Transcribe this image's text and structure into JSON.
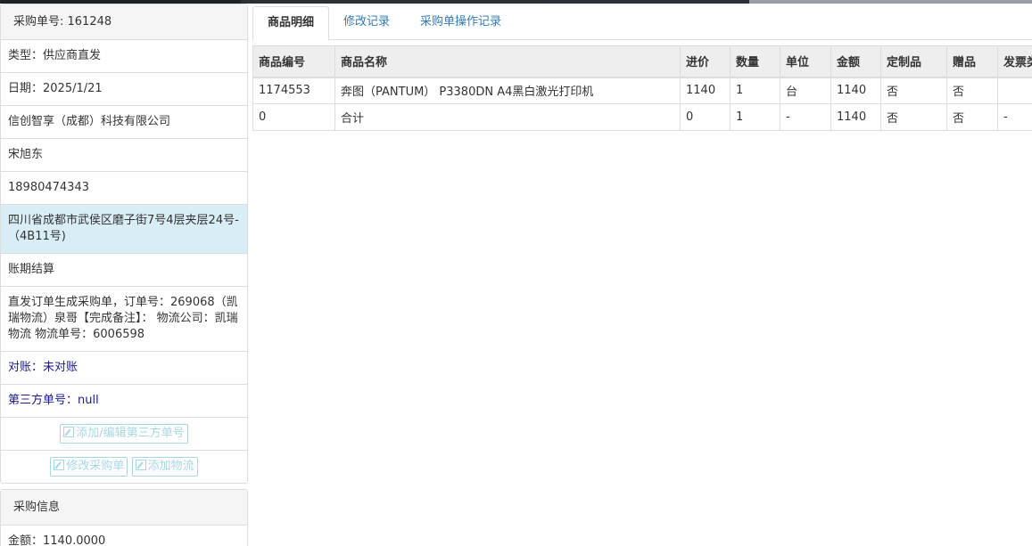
{
  "colors": {
    "link": "#337ab7",
    "highlight_row": "#d9edf7",
    "dark_link": "#1a1a8c",
    "ghost_button": "#a9d6e5"
  },
  "left_panel": {
    "heading": "采购单号: 161248",
    "rows": {
      "type": "类型：供应商直发",
      "date": "日期：2025/1/21",
      "company": "信创智享（成都）科技有限公司",
      "contact": "宋旭东",
      "phone": "18980474343",
      "address": "四川省成都市武侯区磨子街7号4层夹层24号-（4B11号)",
      "settlement": "账期结算",
      "remark": "直发订单生成采购单，订单号：269068（凯瑞物流）泉哥【完成备注】： 物流公司：凯瑞物流 物流单号：6006598",
      "reconcile": "对账：未对账",
      "third_party_no": "第三方单号：null"
    },
    "buttons": {
      "edit_third_party": "添加/编辑第三方单号",
      "modify_order": "修改采购单",
      "add_logistics": "添加物流"
    }
  },
  "purchase_info": {
    "heading": "采购信息",
    "amount": "金额：1140.0000"
  },
  "tabs": [
    "商品明细",
    "修改记录",
    "采购单操作记录"
  ],
  "table": {
    "headers": [
      "商品编号",
      "商品名称",
      "进价",
      "数量",
      "单位",
      "金额",
      "定制品",
      "赠品",
      "发票类"
    ],
    "rows": [
      [
        "1174553",
        "奔图（PANTUM） P3380DN A4黑白激光打印机",
        "1140",
        "1",
        "台",
        "1140",
        "否",
        "否",
        ""
      ],
      [
        "0",
        "合计",
        "0",
        "1",
        "-",
        "1140",
        "否",
        "否",
        "-"
      ]
    ]
  }
}
